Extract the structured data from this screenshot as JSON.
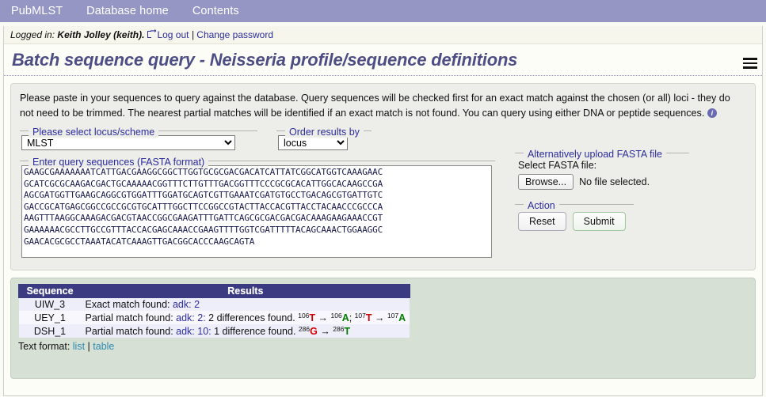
{
  "nav": {
    "items": [
      {
        "label": "PubMLST",
        "name": "nav-pubmlst"
      },
      {
        "label": "Database home",
        "name": "nav-database-home"
      },
      {
        "label": "Contents",
        "name": "nav-contents"
      }
    ]
  },
  "login_bar": {
    "prefix": "Logged in:",
    "user": "Keith Jolley (keith).",
    "logout_label": "Log out",
    "separator": "|",
    "change_password_label": "Change password"
  },
  "page_title": "Batch sequence query - Neisseria profile/sequence definitions",
  "intro": {
    "text": "Please paste in your sequences to query against the database. Query sequences will be checked first for an exact match against the chosen (or all) loci - they do not need to be trimmed. The nearest partial matches will be identified if an exact match is not found. You can query using either DNA or peptide sequences.",
    "info_glyph": "i"
  },
  "form": {
    "locus_legend": "Please select locus/scheme",
    "locus_value": "MLST",
    "order_legend": "Order results by",
    "order_value": "locus",
    "sequences_legend": "Enter query sequences (FASTA format)",
    "sequences_value": "GAAGCGAAAAAAATCATTGACGAAGGCGGCTTGGTGCGCGACGACATCATTATCGGCATGGTCAAAGAAC\nGCATCGCGCAAGACGACTGCAAAAACGGTTTCTTGTTTGACGGTTTCCCGCGCACATTGGCACAAGCCGA\nAGCGATGGTTGAAGCAGGCGTGGATTTGGATGCAGTCGTTGAAATCGATGTGCCTGACAGCGTGATTGTC\nGACCGCATGAGCGGCCGCCGCGTGCATTTGGCTTCCGGCCGTACTTACCACGTTACCTACAACCCGCCCA\nAAGTTTAAGGCAAAGACGACGTAACCGGCGAAGATTTGATTCAGCGCGACGACGACAAAGAAGAAACCGT\nGAAAAAACGCCTTGCCGTTTACCACGAGCAAACCGAAGTTTTGGTCGATTTTTACAGCAAACTGGAAGGC\nGAACACGCGCCTAAATACATCAAAGTTGACGGCACCCAAGCAGTA",
    "upload_legend": "Alternatively upload FASTA file",
    "select_file_label": "Select FASTA file:",
    "browse_label": "Browse...",
    "no_file_label": "No file selected.",
    "action_legend": "Action",
    "reset_label": "Reset",
    "submit_label": "Submit"
  },
  "results": {
    "columns": [
      "Sequence",
      "Results"
    ],
    "rows": [
      {
        "sequence": "UIW_3",
        "prefix": "Exact match found:",
        "locus": "adk:",
        "allele": "2",
        "detail": "",
        "differences": []
      },
      {
        "sequence": "UEY_1",
        "prefix": "Partial match found:",
        "locus": "adk:",
        "allele": "2:",
        "detail": "2 differences found.",
        "differences": [
          {
            "pos": "106",
            "from": "T",
            "to_pos": "106",
            "to": "A",
            "trailing": ";"
          },
          {
            "pos": "107",
            "from": "T",
            "to_pos": "107",
            "to": "A",
            "trailing": ""
          }
        ]
      },
      {
        "sequence": "DSH_1",
        "prefix": "Partial match found:",
        "locus": "adk:",
        "allele": "10:",
        "detail": "1 difference found.",
        "differences": [
          {
            "pos": "286",
            "from": "G",
            "to_pos": "286",
            "to": "T",
            "trailing": ""
          }
        ]
      }
    ],
    "text_format_label": "Text format:",
    "format_list": "list",
    "format_sep": "|",
    "format_table": "table"
  },
  "colors": {
    "nav_bg": "#9596c4",
    "title": "#4e4e86",
    "link": "#2d2d9e",
    "table_header": "#3b3b82",
    "results_bg": "#d7e0d4",
    "form_bg": "#edede9",
    "nt_removed": "#d10000",
    "nt_added": "#008000"
  }
}
